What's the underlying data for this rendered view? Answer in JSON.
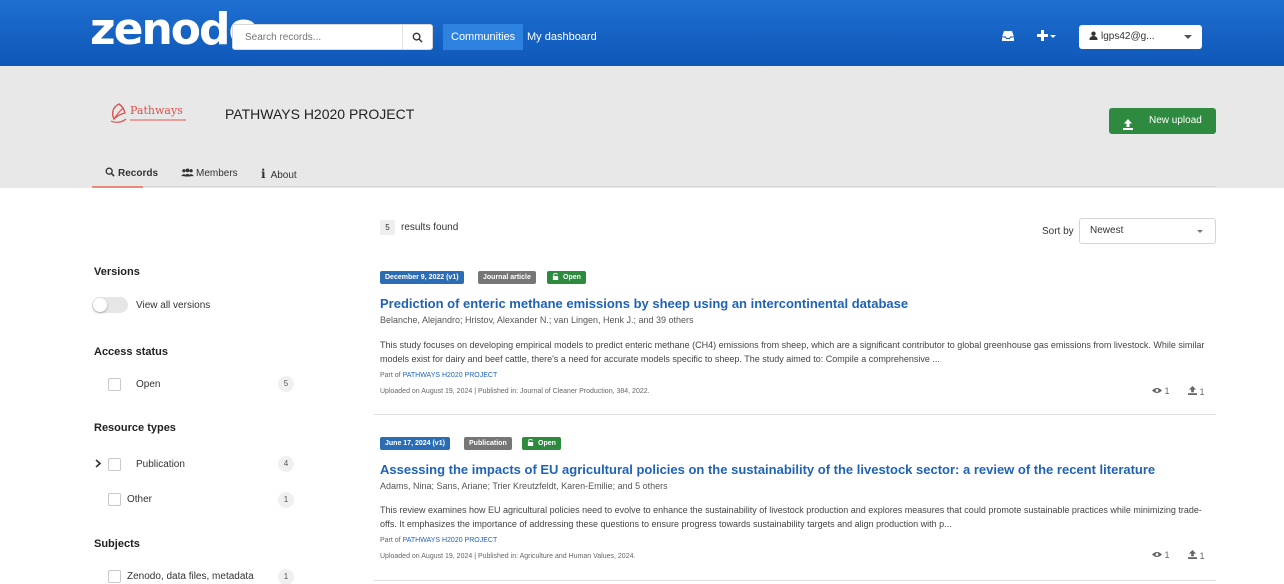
{
  "navbar": {
    "logo": "zenodo",
    "search_placeholder": "Search records...",
    "links": [
      "Communities",
      "My dashboard"
    ],
    "user": "lgps42@g..."
  },
  "community": {
    "logo_text": "Pathways",
    "title": "PATHWAYS H2020 PROJECT",
    "new_upload": "New upload",
    "tabs": [
      "Records",
      "Members",
      "About"
    ]
  },
  "sidebar": {
    "versions_title": "Versions",
    "view_all_versions": "View all versions",
    "access_title": "Access status",
    "access_items": [
      {
        "label": "Open",
        "count": "5"
      }
    ],
    "resource_title": "Resource types",
    "resource_items": [
      {
        "label": "Publication",
        "count": "4"
      },
      {
        "label": "Other",
        "count": "1"
      }
    ],
    "subjects_title": "Subjects",
    "subject_items": [
      {
        "label": "Zenodo, data files, metadata",
        "count": "1"
      }
    ]
  },
  "results": {
    "count": "5",
    "count_label": "results found",
    "sort_label": "Sort by",
    "sort_value": "Newest"
  },
  "records": [
    {
      "date": "December 9, 2022 (v1)",
      "type": "Journal article",
      "access": "Open",
      "title": "Prediction of enteric methane emissions by sheep using an intercontinental database",
      "authors": "Belanche, Alejandro;  Hristov, Alexander N.;  van Lingen, Henk J.;  and 39 others",
      "description": "This study focuses on developing empirical models to predict enteric methane (CH4) emissions from sheep, which are a significant contributor to global greenhouse gas emissions from livestock. While similar models exist for dairy and beef cattle, there's a need for accurate models specific to sheep. The study aimed to: Compile a comprehensive ...",
      "part_of_label": "Part of",
      "part_of": "PATHWAYS H2020 PROJECT",
      "meta": "Uploaded on August 19, 2024 | Published in: Journal of Cleaner Production, 384, 2022.",
      "views": "1",
      "downloads": "1"
    },
    {
      "date": "June 17, 2024 (v1)",
      "type": "Publication",
      "access": "Open",
      "title": "Assessing the impacts of EU agricultural policies on the sustainability of the livestock sector: a review of the recent literature",
      "authors": "Adams, Nina;  Sans, Ariane;  Trier Kreutzfeldt, Karen-Emilie;  and 5 others",
      "description": "This review examines how EU agricultural policies need to evolve to enhance the sustainability of livestock production and explores measures that could promote sustainable practices while minimizing trade-offs. It emphasizes the importance of addressing these questions to ensure progress towards sustainability targets and align production with p...",
      "part_of_label": "Part of",
      "part_of": "PATHWAYS H2020 PROJECT",
      "meta": "Uploaded on August 19, 2024 | Published in: Agriculture and Human Values, 2024.",
      "views": "1",
      "downloads": "1"
    }
  ],
  "colors": {
    "navbar": "#0e57b8",
    "link": "#1f63b5",
    "open": "#2d8a3e",
    "date_badge": "#2a6db5",
    "type_badge": "#767676"
  }
}
